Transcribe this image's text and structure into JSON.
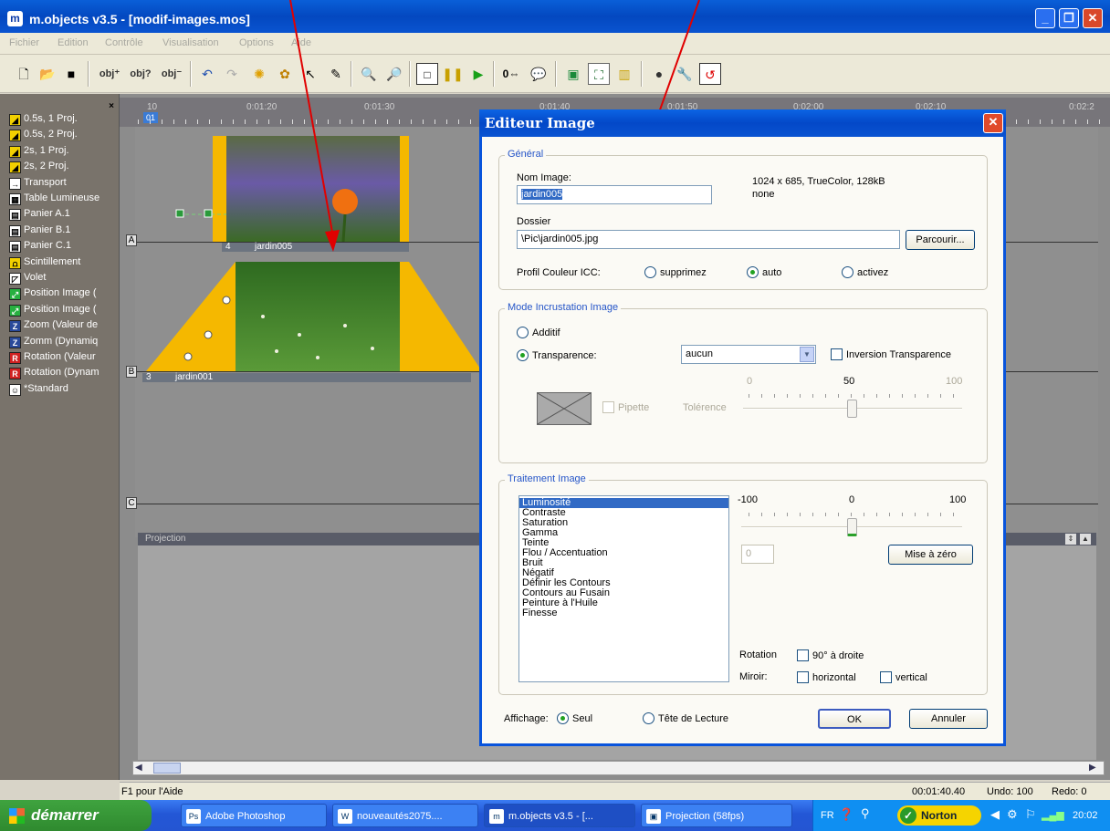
{
  "window": {
    "title": "m.objects v3.5 - [modif-images.mos]",
    "app_icon": "m.objects-icon"
  },
  "menu": [
    "Fichier",
    "Edition",
    "Contrôle",
    "Visualisation",
    "Options",
    "Aide"
  ],
  "left_panel": {
    "items": [
      {
        "label": "0.5s, 1 Proj.",
        "icon": "fade-icon",
        "color": "#f2d000"
      },
      {
        "label": "0.5s, 2 Proj.",
        "icon": "fade-icon",
        "color": "#f2d000"
      },
      {
        "label": "2s, 1 Proj.",
        "icon": "fade-icon",
        "color": "#f2d000"
      },
      {
        "label": "2s, 2 Proj.",
        "icon": "fade-icon",
        "color": "#f2d000"
      },
      {
        "label": "Transport",
        "icon": "arrow-right-icon",
        "color": "#ffffff"
      },
      {
        "label": "Table Lumineuse",
        "icon": "light-table-icon",
        "color": "#ffffff"
      },
      {
        "label": "Panier A.1",
        "icon": "tray-icon",
        "color": "#ffffff"
      },
      {
        "label": "Panier B.1",
        "icon": "tray-icon",
        "color": "#ffffff"
      },
      {
        "label": "Panier C.1",
        "icon": "tray-icon",
        "color": "#ffffff"
      },
      {
        "label": "Scintillement",
        "icon": "flicker-icon",
        "color": "#f2d000"
      },
      {
        "label": "Volet",
        "icon": "wipe-icon",
        "color": "#ffffff"
      },
      {
        "label": "Position Image (",
        "icon": "position-icon",
        "color": "#27b040"
      },
      {
        "label": "Position Image (",
        "icon": "position-icon",
        "color": "#27b040"
      },
      {
        "label": "Zoom (Valeur de",
        "icon": "zoom-icon",
        "color": "#2a4a9a"
      },
      {
        "label": "Zomm (Dynamiq",
        "icon": "zoom-icon",
        "color": "#2a4a9a"
      },
      {
        "label": "Rotation (Valeur",
        "icon": "rotation-icon",
        "color": "#d02020"
      },
      {
        "label": "Rotation (Dynam",
        "icon": "rotation-icon",
        "color": "#d02020"
      },
      {
        "label": "*Standard",
        "icon": "standard-icon",
        "color": "#ffffff"
      }
    ]
  },
  "timeline": {
    "ruler": [
      "10",
      "0:01:20",
      "0:01:30",
      "0:01:40",
      "0:01:50",
      "0:02:00",
      "0:02:10",
      "0:02:2"
    ],
    "marker": "01",
    "tracks": [
      "A",
      "B",
      "C"
    ],
    "clips": [
      {
        "num": "4",
        "name": "jardin005"
      },
      {
        "num": "3",
        "name": "jardin001"
      }
    ],
    "projection_label": "Projection"
  },
  "status": {
    "help": "F1 pour l'Aide",
    "time": "00:01:40.40",
    "undo": "Undo: 100",
    "redo": "Redo: 0"
  },
  "taskbar": {
    "start": "démarrer",
    "tasks": [
      "Adobe Photoshop",
      "nouveautés2075....",
      "m.objects v3.5 - [...",
      "Projection (58fps)"
    ],
    "lang": "FR",
    "norton": "Norton",
    "clock": "20:02"
  },
  "dialog": {
    "title": "Editeur Image",
    "general": {
      "legend": "Général",
      "name_label": "Nom Image:",
      "name_value": "jardin005",
      "info1": "1024 x 685, TrueColor, 128kB",
      "info2": "none",
      "folder_label": "Dossier",
      "folder_value": "\\Pic\\jardin005.jpg",
      "browse": "Parcourir...",
      "icc_label": "Profil Couleur ICC:",
      "icc_options": [
        "supprimez",
        "auto",
        "activez"
      ]
    },
    "incrust": {
      "legend": "Mode Incrustation Image",
      "additive": "Additif",
      "transparency": "Transparence:",
      "transp_value": "aucun",
      "inversion": "Inversion Transparence",
      "pipette": "Pipette",
      "tolerance": "Tolérence",
      "scale": [
        "0",
        "50",
        "100"
      ],
      "tolerance_value": 50
    },
    "traitement": {
      "legend": "Traitement Image",
      "items": [
        "Luminosité",
        "Contraste",
        "Saturation",
        "Gamma",
        "Teinte",
        "Flou / Accentuation",
        "Bruit",
        "Négatif",
        "Définir les Contours",
        "Contours au Fusain",
        "Peinture à l'Huile",
        "Finesse"
      ],
      "selected": 0,
      "scale": [
        "-100",
        "0",
        "100"
      ],
      "value": "0",
      "reset": "Mise à zéro",
      "rotation_label": "Rotation",
      "rotation_option": "90° à droite",
      "mirror_label": "Miroir:",
      "mirror_options": [
        "horizontal",
        "vertical"
      ]
    },
    "display": {
      "label": "Affichage:",
      "options": [
        "Seul",
        "Tête de Lecture"
      ]
    },
    "ok": "OK",
    "cancel": "Annuler"
  }
}
